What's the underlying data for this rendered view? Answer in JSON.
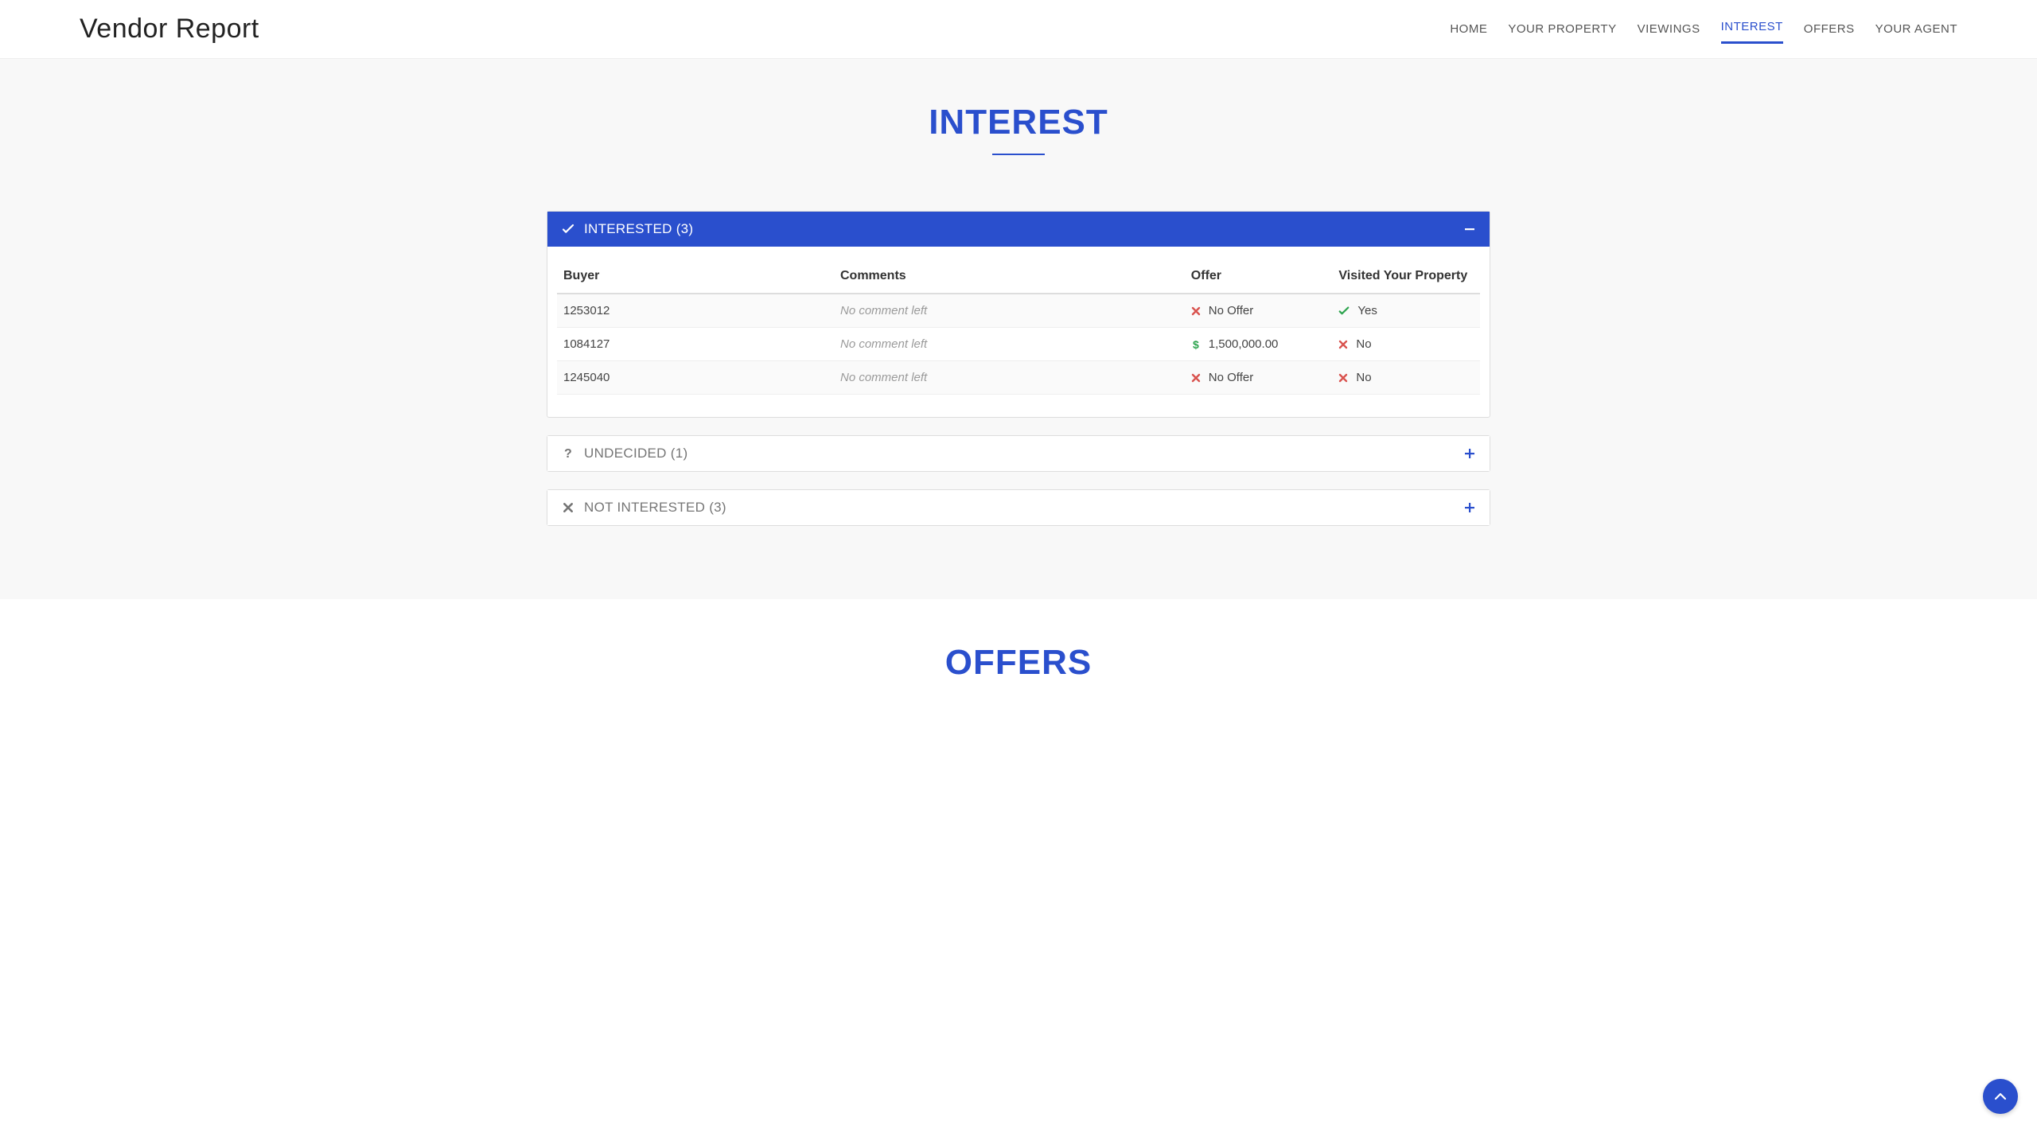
{
  "header": {
    "title": "Vendor Report",
    "nav": [
      {
        "label": "HOME",
        "active": false
      },
      {
        "label": "YOUR PROPERTY",
        "active": false
      },
      {
        "label": "VIEWINGS",
        "active": false
      },
      {
        "label": "INTEREST",
        "active": true
      },
      {
        "label": "OFFERS",
        "active": false
      },
      {
        "label": "YOUR AGENT",
        "active": false
      }
    ]
  },
  "interest": {
    "section_title": "INTEREST",
    "panels": {
      "interested": {
        "icon": "check-icon",
        "title": "INTERESTED (3)",
        "expanded": true,
        "columns": [
          "Buyer",
          "Comments",
          "Offer",
          "Visited Your Property"
        ],
        "rows": [
          {
            "buyer": "1253012",
            "comment": "No comment left",
            "comment_empty": true,
            "offer_icon": "x-icon",
            "offer_text": "No Offer",
            "visited_icon": "check-icon",
            "visited_text": "Yes",
            "visited_positive": true
          },
          {
            "buyer": "1084127",
            "comment": "No comment left",
            "comment_empty": true,
            "offer_icon": "dollar-icon",
            "offer_text": "1,500,000.00",
            "visited_icon": "x-icon",
            "visited_text": "No",
            "visited_positive": false
          },
          {
            "buyer": "1245040",
            "comment": "No comment left",
            "comment_empty": true,
            "offer_icon": "x-icon",
            "offer_text": "No Offer",
            "visited_icon": "x-icon",
            "visited_text": "No",
            "visited_positive": false
          }
        ]
      },
      "undecided": {
        "icon": "question-icon",
        "title": "UNDECIDED (1)",
        "expanded": false
      },
      "not_interested": {
        "icon": "x-icon",
        "title": "NOT INTERESTED (3)",
        "expanded": false
      }
    }
  },
  "offers": {
    "section_title": "OFFERS"
  }
}
